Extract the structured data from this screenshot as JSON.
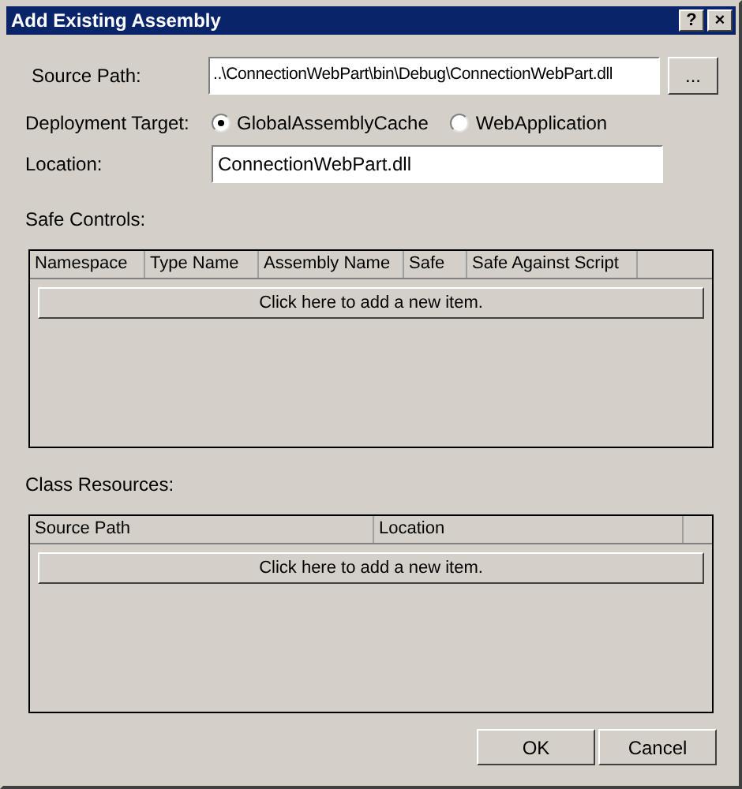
{
  "window": {
    "title": "Add Existing Assembly",
    "title_buttons": [
      "?",
      "×"
    ]
  },
  "source_path": {
    "label": "Source Path:",
    "value": "..\\ConnectionWebPart\\bin\\Debug\\ConnectionWebPart.dll",
    "browse": "..."
  },
  "deployment_target": {
    "label": "Deployment Target:",
    "options": [
      {
        "label": "GlobalAssemblyCache",
        "selected": true
      },
      {
        "label": "WebApplication",
        "selected": false
      }
    ]
  },
  "location": {
    "label": "Location:",
    "value": "ConnectionWebPart.dll"
  },
  "safe_controls": {
    "label": "Safe Controls:",
    "columns": [
      "Namespace",
      "Type Name",
      "Assembly Name",
      "Safe",
      "Safe Against Script"
    ],
    "add_item": "Click here to add a new item."
  },
  "class_resources": {
    "label": "Class Resources:",
    "columns": [
      "Source Path",
      "Location"
    ],
    "add_item": "Click here to add a new item."
  },
  "buttons": [
    "OK",
    "Cancel"
  ]
}
